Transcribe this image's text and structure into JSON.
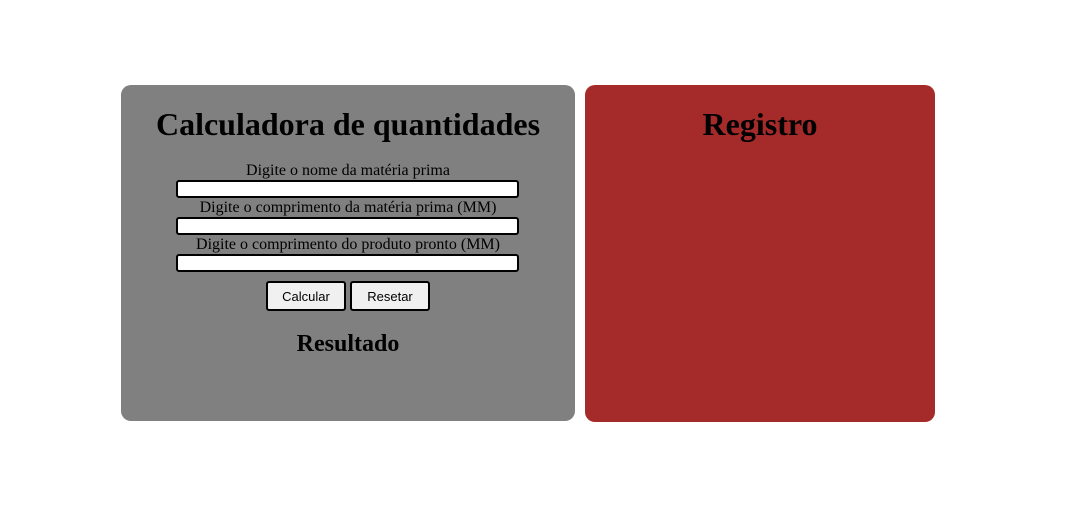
{
  "calculator": {
    "title": "Calculadora de quantidades",
    "fields": [
      {
        "label": "Digite o nome da matéria prima",
        "value": ""
      },
      {
        "label": "Digite o comprimento da matéria prima (MM)",
        "value": ""
      },
      {
        "label": "Digite o comprimento do produto pronto (MM)",
        "value": ""
      }
    ],
    "buttons": {
      "calculate_label": "Calcular",
      "reset_label": "Resetar"
    },
    "result_title": "Resultado",
    "background_color": "#808080"
  },
  "registro": {
    "title": "Registro",
    "background_color": "#a52a2a"
  }
}
